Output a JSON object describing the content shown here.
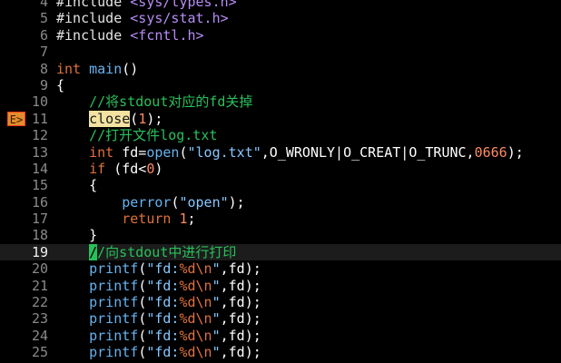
{
  "editor": {
    "current_line": 19,
    "sign_text": "E>",
    "lines": [
      {
        "num": "4",
        "tokens": [
          [
            "#include ",
            "pre"
          ],
          [
            "<sys/types.h>",
            "inc"
          ]
        ]
      },
      {
        "num": "5",
        "tokens": [
          [
            "#include ",
            "pre"
          ],
          [
            "<sys/stat.h>",
            "inc"
          ]
        ]
      },
      {
        "num": "6",
        "tokens": [
          [
            "#include ",
            "pre"
          ],
          [
            "<fcntl.h>",
            "inc"
          ]
        ]
      },
      {
        "num": "7",
        "tokens": []
      },
      {
        "num": "8",
        "tokens": [
          [
            "int",
            "type"
          ],
          [
            " ",
            ""
          ],
          [
            "main",
            "fn"
          ],
          [
            "()",
            ""
          ]
        ]
      },
      {
        "num": "9",
        "tokens": [
          [
            "{",
            ""
          ]
        ]
      },
      {
        "num": "10",
        "tokens": [
          [
            "    ",
            ""
          ],
          [
            "//将stdout对应的fd关掉",
            "com"
          ]
        ]
      },
      {
        "num": "11",
        "sign": true,
        "tokens": [
          [
            "    ",
            ""
          ],
          [
            "close",
            "hl"
          ],
          [
            "(",
            ""
          ],
          [
            "1",
            "num"
          ],
          [
            ");",
            ""
          ]
        ]
      },
      {
        "num": "12",
        "tokens": [
          [
            "    ",
            ""
          ],
          [
            "//打开文件log.txt",
            "com"
          ]
        ]
      },
      {
        "num": "13",
        "tokens": [
          [
            "    ",
            ""
          ],
          [
            "int",
            "type"
          ],
          [
            " fd=",
            ""
          ],
          [
            "open",
            "fn"
          ],
          [
            "(",
            ""
          ],
          [
            "\"log.txt\"",
            "str"
          ],
          [
            ",O_WRONLY|O_CREAT|O_TRUNC,",
            ""
          ],
          [
            "0666",
            "num"
          ],
          [
            ");",
            ""
          ]
        ]
      },
      {
        "num": "14",
        "tokens": [
          [
            "    ",
            ""
          ],
          [
            "if",
            "kw"
          ],
          [
            " (fd<",
            ""
          ],
          [
            "0",
            "num"
          ],
          [
            ")",
            ""
          ]
        ]
      },
      {
        "num": "15",
        "tokens": [
          [
            "    {",
            ""
          ]
        ]
      },
      {
        "num": "16",
        "tokens": [
          [
            "        ",
            ""
          ],
          [
            "perror",
            "fn"
          ],
          [
            "(",
            ""
          ],
          [
            "\"open\"",
            "str"
          ],
          [
            ");",
            ""
          ]
        ]
      },
      {
        "num": "17",
        "tokens": [
          [
            "        ",
            ""
          ],
          [
            "return",
            "kw"
          ],
          [
            " ",
            ""
          ],
          [
            "1",
            "num"
          ],
          [
            ";",
            ""
          ]
        ]
      },
      {
        "num": "18",
        "tokens": [
          [
            "    }",
            ""
          ]
        ]
      },
      {
        "num": "19",
        "tokens": [
          [
            "    ",
            ""
          ],
          [
            "/",
            "cursor"
          ],
          [
            "/向stdout中进行打印",
            "com"
          ]
        ]
      },
      {
        "num": "20",
        "tokens": [
          [
            "    ",
            ""
          ],
          [
            "printf",
            "fn"
          ],
          [
            "(",
            ""
          ],
          [
            "\"fd:",
            "str"
          ],
          [
            "%d\\n",
            "esc"
          ],
          [
            "\"",
            "str"
          ],
          [
            ",fd);",
            ""
          ]
        ]
      },
      {
        "num": "21",
        "tokens": [
          [
            "    ",
            ""
          ],
          [
            "printf",
            "fn"
          ],
          [
            "(",
            ""
          ],
          [
            "\"fd:",
            "str"
          ],
          [
            "%d\\n",
            "esc"
          ],
          [
            "\"",
            "str"
          ],
          [
            ",fd);",
            ""
          ]
        ]
      },
      {
        "num": "22",
        "tokens": [
          [
            "    ",
            ""
          ],
          [
            "printf",
            "fn"
          ],
          [
            "(",
            ""
          ],
          [
            "\"fd:",
            "str"
          ],
          [
            "%d\\n",
            "esc"
          ],
          [
            "\"",
            "str"
          ],
          [
            ",fd);",
            ""
          ]
        ]
      },
      {
        "num": "23",
        "tokens": [
          [
            "    ",
            ""
          ],
          [
            "printf",
            "fn"
          ],
          [
            "(",
            ""
          ],
          [
            "\"fd:",
            "str"
          ],
          [
            "%d\\n",
            "esc"
          ],
          [
            "\"",
            "str"
          ],
          [
            ",fd);",
            ""
          ]
        ]
      },
      {
        "num": "24",
        "tokens": [
          [
            "    ",
            ""
          ],
          [
            "printf",
            "fn"
          ],
          [
            "(",
            ""
          ],
          [
            "\"fd:",
            "str"
          ],
          [
            "%d\\n",
            "esc"
          ],
          [
            "\"",
            "str"
          ],
          [
            ",fd);",
            ""
          ]
        ]
      },
      {
        "num": "25",
        "tokens": [
          [
            "    ",
            ""
          ],
          [
            "printf",
            "fn"
          ],
          [
            "(",
            ""
          ],
          [
            "\"fd:",
            "str"
          ],
          [
            "%d\\n",
            "esc"
          ],
          [
            "\"",
            "str"
          ],
          [
            ",fd);",
            ""
          ]
        ]
      }
    ]
  }
}
